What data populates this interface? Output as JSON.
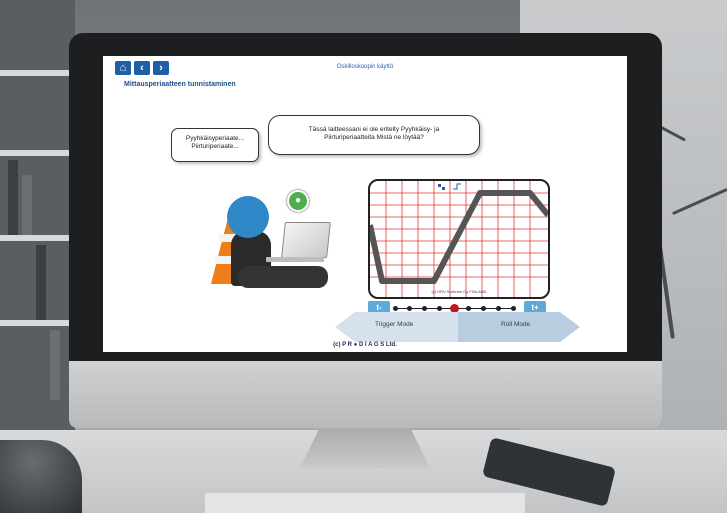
{
  "app": {
    "title": "Oskilloskoopin käyttö",
    "subtitle": "Mittausperiaatteen tunnistaminen",
    "footer": "(c) P R ● D I A G S Ltd."
  },
  "nav": {
    "home_icon": "home-icon",
    "back_icon": "chevron-left-icon",
    "forward_icon": "chevron-right-icon"
  },
  "bubbles": {
    "left": [
      "Pyyhkäisyperiaate...",
      "Piirturiperiaate..."
    ],
    "right": [
      "Tässä laitteessani ei ole eritelty Pyyhkäisy- ja",
      "Piirturiperiaatteita  Mistä ne löytää?"
    ]
  },
  "scope": {
    "copyright": "(c) HRV-Systems Oy FINLAND"
  },
  "timebase": {
    "minus_label": "t-",
    "plus_label": "t+",
    "positions": 9,
    "selected_index": 4
  },
  "modes": {
    "left": "Trigger Mode",
    "right": "Roll Mode"
  },
  "colors": {
    "accent": "#1e5fa8",
    "grid": "#e23a3a",
    "selected_dot": "#c0181e",
    "bulb": "#4cae4c",
    "cone": "#f07d1a"
  }
}
